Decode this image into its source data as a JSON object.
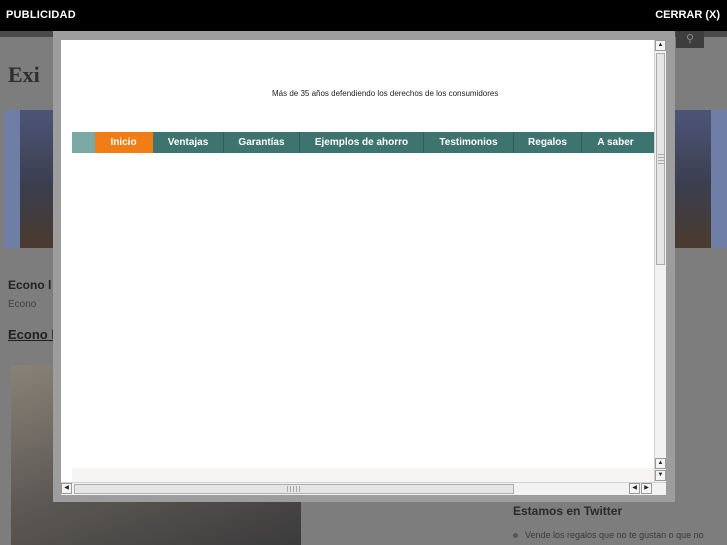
{
  "adbar": {
    "left_label": "PUBLICIDAD",
    "close_label": "CERRAR (X)"
  },
  "background_page": {
    "logo_text": "Exi",
    "heading1": "Econo l",
    "meta_text": "Econo",
    "heading2": "Econo l",
    "sidebar_heading": "Estamos en Twitter",
    "sidebar_item": "Vende los regalos que no te gustan o que no",
    "search_icon": "search-icon"
  },
  "modal": {
    "tagline": "Más de 35 años defendiendo los derechos de los consumidores",
    "nav": [
      {
        "label": "Inicio",
        "active": true
      },
      {
        "label": "Ventajas",
        "active": false
      },
      {
        "label": "Garantías",
        "active": false
      },
      {
        "label": "Ejemplos de ahorro",
        "active": false
      },
      {
        "label": "Testimonios",
        "active": false
      },
      {
        "label": "Regalos",
        "active": false
      },
      {
        "label": "A saber",
        "active": false
      }
    ],
    "colors": {
      "nav_bg": "#3d7470",
      "nav_active": "#f07d16",
      "nav_pad": "#7ba9a6"
    }
  },
  "scrollbars": {
    "up_icon": "arrow-up-icon",
    "down_icon": "arrow-down-icon",
    "left_icon": "arrow-left-icon",
    "right_icon": "arrow-right-icon"
  }
}
